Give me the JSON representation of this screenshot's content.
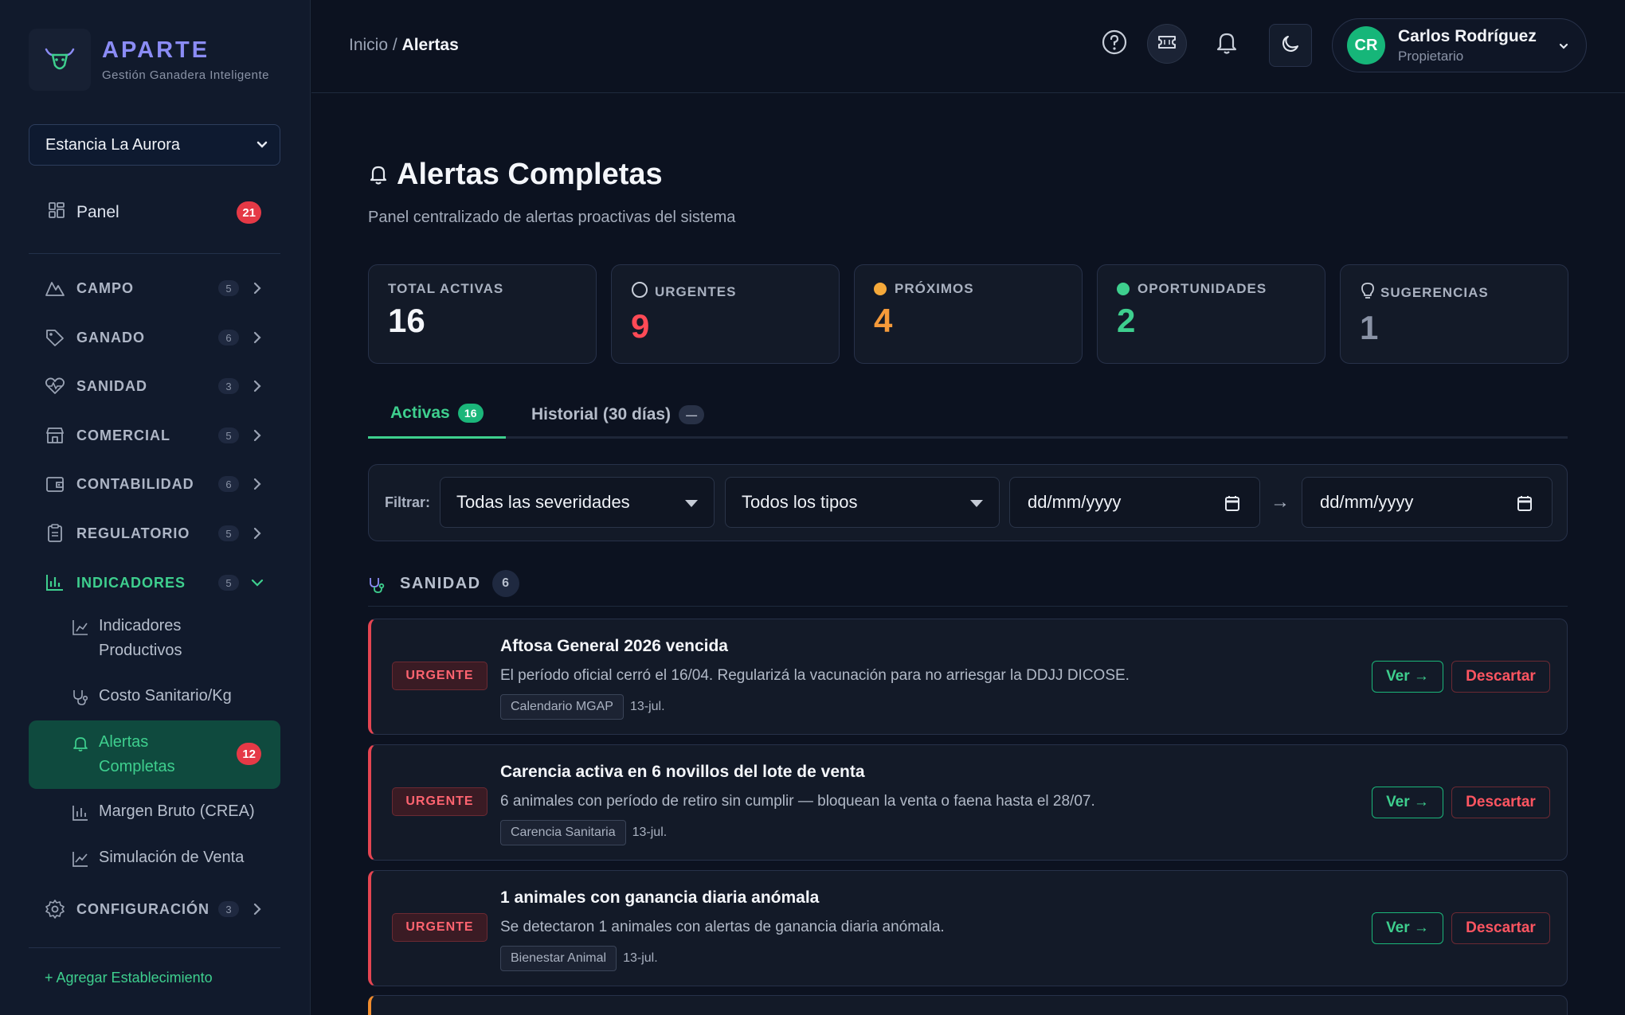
{
  "brand": {
    "name": "APARTE",
    "subtitle": "Gestión Ganadera Inteligente"
  },
  "establishment": {
    "selected": "Estancia La Aurora"
  },
  "sidebar": {
    "panel": {
      "label": "Panel",
      "badge": "21"
    },
    "sections": [
      {
        "label": "CAMPO",
        "count": "5",
        "icon": "mountain-icon"
      },
      {
        "label": "GANADO",
        "count": "6",
        "icon": "tag-icon"
      },
      {
        "label": "SANIDAD",
        "count": "3",
        "icon": "heart-pulse-icon"
      },
      {
        "label": "COMERCIAL",
        "count": "5",
        "icon": "store-icon"
      },
      {
        "label": "CONTABILIDAD",
        "count": "6",
        "icon": "wallet-icon"
      },
      {
        "label": "REGULATORIO",
        "count": "5",
        "icon": "clipboard-icon"
      },
      {
        "label": "INDICADORES",
        "count": "5",
        "icon": "bar-chart-icon",
        "expanded": true
      },
      {
        "label": "CONFIGURACIÓN",
        "count": "3",
        "icon": "gear-icon"
      }
    ],
    "subitems": [
      {
        "label": "Indicadores Productivos"
      },
      {
        "label": "Costo Sanitario/Kg"
      },
      {
        "label": "Alertas Completas",
        "badge": "12",
        "active": true
      },
      {
        "label": "Margen Bruto (CREA)"
      },
      {
        "label": "Simulación de Venta"
      }
    ],
    "add_establishment": "+ Agregar Establecimiento"
  },
  "topbar": {
    "breadcrumb_root": "Inicio /",
    "breadcrumb_current": "Alertas",
    "user": {
      "initials": "CR",
      "name": "Carlos Rodríguez",
      "role": "Propietario"
    }
  },
  "page": {
    "title": "Alertas Completas",
    "subtitle": "Panel centralizado de alertas proactivas del sistema"
  },
  "stats": [
    {
      "label": "TOTAL ACTIVAS",
      "value": "16",
      "color": "#f4f6fa"
    },
    {
      "label": "URGENTES",
      "value": "9",
      "color": "#ff4a56"
    },
    {
      "label": "PRÓXIMOS",
      "value": "4",
      "color": "#f59a3a"
    },
    {
      "label": "OPORTUNIDADES",
      "value": "2",
      "color": "#3ecf8e"
    },
    {
      "label": "SUGERENCIAS",
      "value": "1",
      "color": "#8a93a6"
    }
  ],
  "tabs": [
    {
      "label": "Activas",
      "badge": "16"
    },
    {
      "label": "Historial (30 días)",
      "badge": "—"
    }
  ],
  "filters": {
    "label": "Filtrar:",
    "severity": "Todas las severidades",
    "type": "Todos los tipos",
    "date_from_placeholder": "dd/mm/yyyy",
    "date_to_placeholder": "dd/mm/yyyy",
    "range_arrow": "→"
  },
  "group": {
    "label": "SANIDAD",
    "count": "6"
  },
  "alerts": [
    {
      "severity": "URGENTE",
      "title": "Aftosa General 2026 vencida",
      "description": "El período oficial cerró el 16/04. Regularizá la vacunación para no arriesgar la DDJJ DICOSE.",
      "tag": "Calendario MGAP",
      "date": "13-jul.",
      "view_label": "Ver →",
      "dismiss_label": "Descartar"
    },
    {
      "severity": "URGENTE",
      "title": "Carencia activa en 6 novillos del lote de venta",
      "description": "6 animales con período de retiro sin cumplir — bloquean la venta o faena hasta el 28/07.",
      "tag": "Carencia Sanitaria",
      "date": "13-jul.",
      "view_label": "Ver →",
      "dismiss_label": "Descartar"
    },
    {
      "severity": "URGENTE",
      "title": "1 animales con ganancia diaria anómala",
      "description": "Se detectaron 1 animales con alertas de ganancia diaria anómala.",
      "tag": "Bienestar Animal",
      "date": "13-jul.",
      "view_label": "Ver →",
      "dismiss_label": "Descartar"
    }
  ],
  "colors": {
    "accent": "#3ecf8e",
    "urgent": "#ff4a56",
    "upcoming": "#f59a3a",
    "brand": "#8b8cf5"
  }
}
